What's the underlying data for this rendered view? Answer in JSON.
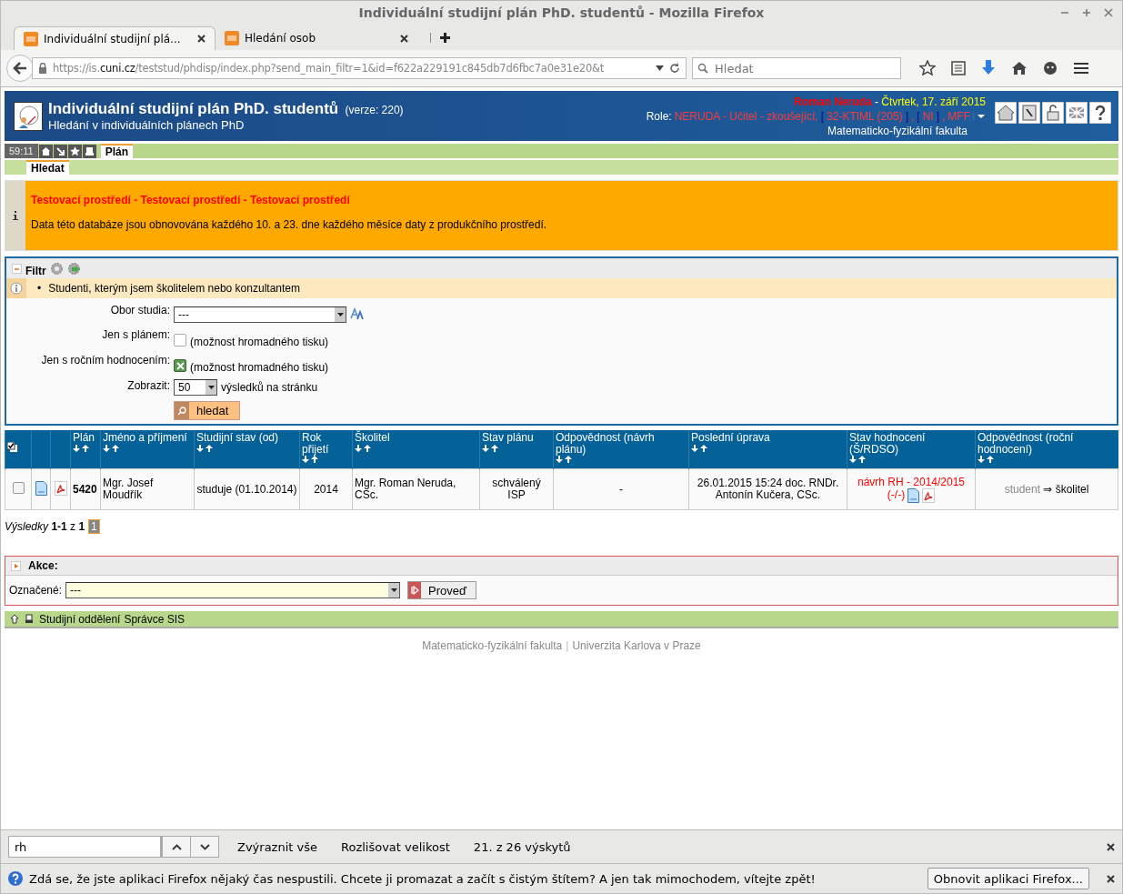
{
  "window": {
    "title": "Individuální studijní plán PhD. studentů - Mozilla Firefox"
  },
  "browser": {
    "tabs": [
      {
        "label": "Individuální studijní plá...",
        "selected": true
      },
      {
        "label": "Hledání osob",
        "selected": false
      }
    ],
    "url_prefix": "https://is.",
    "url_domain": "cuni.cz",
    "url_rest": "/teststud/phdisp/index.php?send_main_filtr=1&id=f622a229191c845db7d6fbc7a0e31e20&t",
    "search_placeholder": "Hledat"
  },
  "header": {
    "title": "Individuální studijní plán PhD. studentů",
    "version": "(verze: 220)",
    "subtitle": "Hledání v individuálních plánech PhD",
    "user": "Roman Neruda",
    "separator": "-",
    "date": "Čtvrtek, 17. září 2015",
    "role_label": "Role:",
    "roles": [
      {
        "text": "NERUDA - Učitel - zkoušející,",
        "kind": "role"
      },
      {
        "text": "[",
        "kind": "bracket"
      },
      {
        "text": "32-KTIML (205)",
        "kind": "role"
      },
      {
        "text": "]",
        "kind": "bracket"
      },
      {
        "text": ",",
        "kind": "role"
      },
      {
        "text": "[",
        "kind": "bracket"
      },
      {
        "text": "NI",
        "kind": "role"
      },
      {
        "text": "]",
        "kind": "bracket"
      },
      {
        "text": ",",
        "kind": "role"
      },
      {
        "text": "MFF",
        "kind": "role"
      }
    ],
    "faculty": "Matematicko-fyzikální fakulta"
  },
  "nav": {
    "timer": "59:11",
    "tabs": [
      {
        "label": "Plán",
        "selected": true
      }
    ],
    "subtabs": [
      {
        "label": "Hledat",
        "selected": true
      }
    ]
  },
  "notice": {
    "title": "Testovací prostředí - Testovací prostředí - Testovací prostředí",
    "text": "Data této databáze jsou obnovována každého 10. a 23. dne každého měsíce daty z produkčního prostředí."
  },
  "filter": {
    "title": "Filtr",
    "info_marker": "•",
    "info": "Studenti, kterým jsem školitelem nebo konzultantem",
    "obor": {
      "label": "Obor studia:",
      "value": "---"
    },
    "checks": [
      {
        "label": "Jen s plánem:",
        "checked": false,
        "note": "(možnost hromadného tisku)"
      },
      {
        "label": "Jen s ročním hodnocením:",
        "checked": true,
        "note": "(možnost hromadného tisku)"
      }
    ],
    "per_page": {
      "label": "Zobrazit:",
      "value": "50",
      "suffix": "výsledků na stránku"
    },
    "button": "hledat"
  },
  "table": {
    "columns": [
      {
        "label": "Plán"
      },
      {
        "label": "Jméno a příjmení"
      },
      {
        "label": "Studijní stav (od)"
      },
      {
        "label": "Rok přijetí"
      },
      {
        "label": "Školitel"
      },
      {
        "label": "Stav plánu"
      },
      {
        "label": "Odpovědnost (návrh plánu)"
      },
      {
        "label": "Poslední úprava"
      },
      {
        "label": "Stav hodnocení (Š/RDSO)"
      },
      {
        "label": "Odpovědnost (roční hodnocení)"
      }
    ],
    "rows": [
      {
        "checked": false,
        "plan": "5420",
        "name": "Mgr. Josef Moudřík",
        "status": "studuje (01.10.2014)",
        "year": "2014",
        "supervisor": "Mgr. Roman Neruda, CSc.",
        "plan_state": "schválený ISP",
        "responsibility": "-",
        "last_edit": "26.01.2015 15:24 doc. RNDr. Antonín Kučera, CSc.",
        "evaluation": "návrh RH - 2014/2015",
        "evaluation_score": "(-/-)",
        "resp_from": "student",
        "resp_arrow": "⇒",
        "resp_to": "školitel"
      }
    ]
  },
  "pagination": {
    "label": "Výsledky",
    "range": "1-1",
    "of": "z",
    "total": "1",
    "pages": [
      {
        "label": "1",
        "selected": true
      }
    ]
  },
  "actions": {
    "title": "Akce:",
    "label": "Označené:",
    "value": "---",
    "button": "Proveď"
  },
  "footer_links": [
    "Studijní oddělení",
    "Správce SIS"
  ],
  "footer": {
    "left": "Matematicko-fyzikální fakulta",
    "separator": "|",
    "right": "Univerzita Karlova v Praze"
  },
  "findbar": {
    "value": "rh",
    "highlight": "Zvýraznit vše",
    "match_case": "Rozlišovat velikost",
    "result": "21. z 26 výskytů"
  },
  "notification": {
    "text": "Zdá se, že jste aplikaci Firefox nějaký čas nespustili. Chcete ji promazat a začít s čistým štítem? A jen tak mimochodem, vítejte zpět!",
    "button": "Obnovit aplikaci Firefox..."
  }
}
